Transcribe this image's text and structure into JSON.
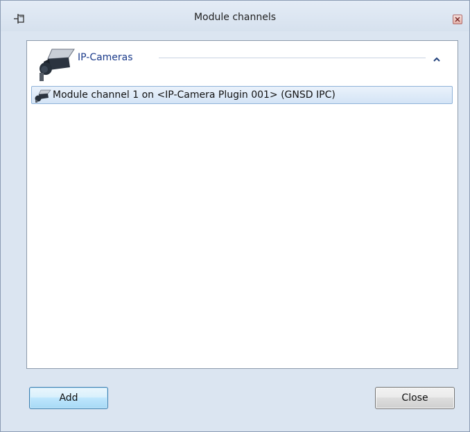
{
  "window": {
    "title": "Module channels"
  },
  "icons": {
    "pin": "pin-icon",
    "close": "close-icon",
    "camera": "ip-camera-icon",
    "collapse": "chevron-up-icon"
  },
  "colors": {
    "window_bg": "#dbe5f1",
    "group_title": "#1a3a8a",
    "selection_border": "#8fb2d8",
    "primary_button_border": "#3c7fb1"
  },
  "group": {
    "title": "IP-Cameras",
    "items": [
      {
        "label": "Module channel 1 on <IP-Camera Plugin 001> (GNSD IPC)"
      }
    ]
  },
  "buttons": {
    "add_label": "Add",
    "close_label": "Close"
  }
}
